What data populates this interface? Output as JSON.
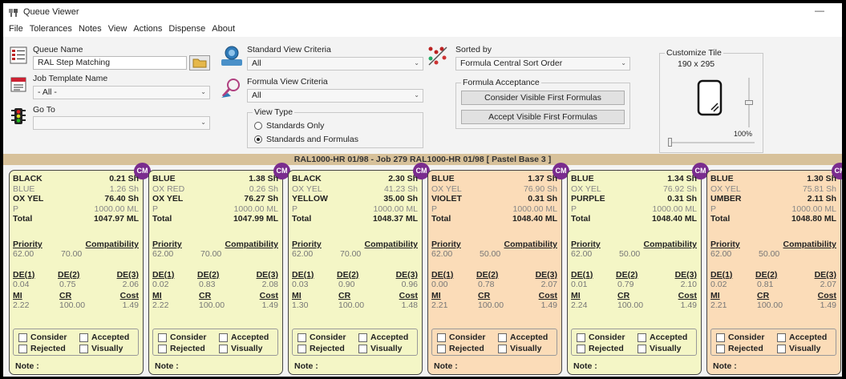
{
  "app": {
    "title": "Queue Viewer",
    "minimize": "—"
  },
  "menu": [
    "File",
    "Tolerances",
    "Notes",
    "View",
    "Actions",
    "Dispense",
    "About"
  ],
  "criteria": {
    "queue_name_label": "Queue Name",
    "queue_name_value": "RAL Step Matching",
    "job_template_label": "Job Template Name",
    "job_template_value": "- All -",
    "goto_label": "Go To",
    "goto_value": "",
    "standard_view_label": "Standard View Criteria",
    "standard_view_value": "All",
    "formula_view_label": "Formula View Criteria",
    "formula_view_value": "All",
    "view_type_label": "View Type",
    "view_type_options": [
      "Standards Only",
      "Standards and Formulas"
    ],
    "view_type_selected": 1,
    "sorted_by_label": "Sorted by",
    "sorted_by_value": "Formula Central Sort Order",
    "formula_acceptance_label": "Formula Acceptance",
    "consider_btn": "Consider Visible First Formulas",
    "accept_btn": "Accept Visible First Formulas",
    "customize_tile_label": "Customize Tile",
    "tile_size": "190  x  295",
    "zoom": "100%"
  },
  "banner": {
    "text": "RAL1000-HR 01/98   -   Job 279 RAL1000-HR 01/98   [ Pastel Base 3 ]"
  },
  "tile_labels": {
    "badge": "CM",
    "total": "Total",
    "priority": "Priority",
    "compatibility": "Compatibility",
    "de1": "DE(1)",
    "de2": "DE(2)",
    "de3": "DE(3)",
    "mi": "MI",
    "cr": "CR",
    "cost": "Cost",
    "consider": "Consider",
    "accepted": "Accepted",
    "rejected": "Rejected",
    "visually": "Visually",
    "note": "Note :"
  },
  "tiles": [
    {
      "color": "yellow",
      "rows": [
        {
          "n": "BLACK",
          "v": "0.21 Sh",
          "style": "bold"
        },
        {
          "n": "BLUE",
          "v": "1.26 Sh",
          "style": "gray"
        },
        {
          "n": "OX YEL",
          "v": "76.40 Sh",
          "style": "bold"
        },
        {
          "n": "P",
          "v": "1000.00 ML",
          "style": "gray"
        }
      ],
      "total": "1047.97 ML",
      "priority": "62.00",
      "compatibility": "70.00",
      "de1": "0.04",
      "de2": "0.75",
      "de3": "2.06",
      "mi": "2.22",
      "cr": "100.00",
      "cost": "1.49"
    },
    {
      "color": "yellow",
      "rows": [
        {
          "n": "BLUE",
          "v": "1.38 Sh",
          "style": "bold"
        },
        {
          "n": "OX RED",
          "v": "0.26 Sh",
          "style": "gray"
        },
        {
          "n": "OX YEL",
          "v": "76.27 Sh",
          "style": "bold"
        },
        {
          "n": "P",
          "v": "1000.00 ML",
          "style": "gray"
        }
      ],
      "total": "1047.99 ML",
      "priority": "62.00",
      "compatibility": "70.00",
      "de1": "0.02",
      "de2": "0.83",
      "de3": "2.08",
      "mi": "2.22",
      "cr": "100.00",
      "cost": "1.49"
    },
    {
      "color": "yellow",
      "rows": [
        {
          "n": "BLACK",
          "v": "2.30 Sh",
          "style": "bold"
        },
        {
          "n": "OX YEL",
          "v": "41.23 Sh",
          "style": "gray"
        },
        {
          "n": "YELLOW",
          "v": "35.00 Sh",
          "style": "bold"
        },
        {
          "n": "P",
          "v": "1000.00 ML",
          "style": "gray"
        }
      ],
      "total": "1048.37 ML",
      "priority": "62.00",
      "compatibility": "70.00",
      "de1": "0.03",
      "de2": "0.90",
      "de3": "0.96",
      "mi": "1.30",
      "cr": "100.00",
      "cost": "1.48"
    },
    {
      "color": "orange",
      "rows": [
        {
          "n": "BLUE",
          "v": "1.37 Sh",
          "style": "bold"
        },
        {
          "n": "OX YEL",
          "v": "76.90 Sh",
          "style": "gray"
        },
        {
          "n": "VIOLET",
          "v": "0.31 Sh",
          "style": "bold"
        },
        {
          "n": "P",
          "v": "1000.00 ML",
          "style": "gray"
        }
      ],
      "total": "1048.40 ML",
      "priority": "62.00",
      "compatibility": "50.00",
      "de1": "0.00",
      "de2": "0.78",
      "de3": "2.07",
      "mi": "2.21",
      "cr": "100.00",
      "cost": "1.49"
    },
    {
      "color": "yellow",
      "rows": [
        {
          "n": "BLUE",
          "v": "1.34 Sh",
          "style": "bold"
        },
        {
          "n": "OX YEL",
          "v": "76.92 Sh",
          "style": "gray"
        },
        {
          "n": "PURPLE",
          "v": "0.31 Sh",
          "style": "bold"
        },
        {
          "n": "P",
          "v": "1000.00 ML",
          "style": "gray"
        }
      ],
      "total": "1048.40 ML",
      "priority": "62.00",
      "compatibility": "50.00",
      "de1": "0.01",
      "de2": "0.79",
      "de3": "2.10",
      "mi": "2.24",
      "cr": "100.00",
      "cost": "1.49"
    },
    {
      "color": "orange",
      "rows": [
        {
          "n": "BLUE",
          "v": "1.30 Sh",
          "style": "bold"
        },
        {
          "n": "OX YEL",
          "v": "75.81 Sh",
          "style": "gray"
        },
        {
          "n": "UMBER",
          "v": "2.11 Sh",
          "style": "bold"
        },
        {
          "n": "P",
          "v": "1000.00 ML",
          "style": "gray"
        }
      ],
      "total": "1048.80 ML",
      "priority": "62.00",
      "compatibility": "50.00",
      "de1": "0.02",
      "de2": "0.81",
      "de3": "2.07",
      "mi": "2.21",
      "cr": "100.00",
      "cost": "1.49"
    }
  ],
  "colors": {
    "tile_yellow": "#f4f6c6",
    "tile_orange": "#fbdcb8",
    "badge": "#7a2c8e",
    "banner": "#d7c19a"
  }
}
